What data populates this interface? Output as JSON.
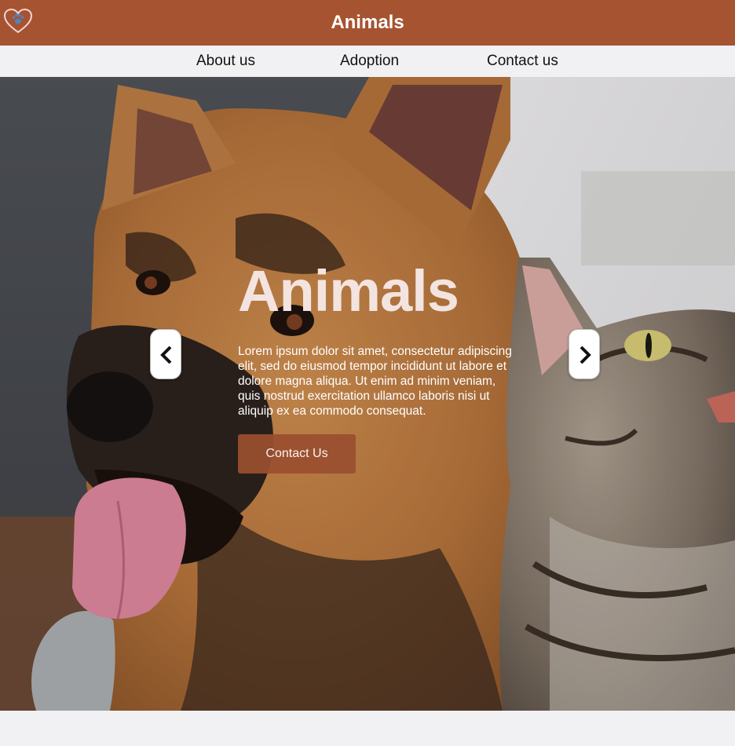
{
  "header": {
    "title": "Animals",
    "logo_icon": "heart-paw-icon",
    "background_color": "#a65331"
  },
  "nav": {
    "items": [
      {
        "label": "About us"
      },
      {
        "label": "Adoption"
      },
      {
        "label": "Contact us"
      }
    ]
  },
  "hero": {
    "heading": "Animals",
    "paragraph": "Lorem ipsum dolor sit amet, consectetur adipiscing elit, sed do eiusmod tempor incididunt ut labore et dolore magna aliqua. Ut enim ad minim veniam, quis nostrud exercitation ullamco laboris nisi ut aliquip ex ea commodo consequat.",
    "button_label": "Contact Us",
    "button_color": "#9a4f2f",
    "prev_icon": "chevron-left-icon",
    "next_icon": "chevron-right-icon",
    "image_subject": "german-shepherd-and-tabby-cat"
  }
}
